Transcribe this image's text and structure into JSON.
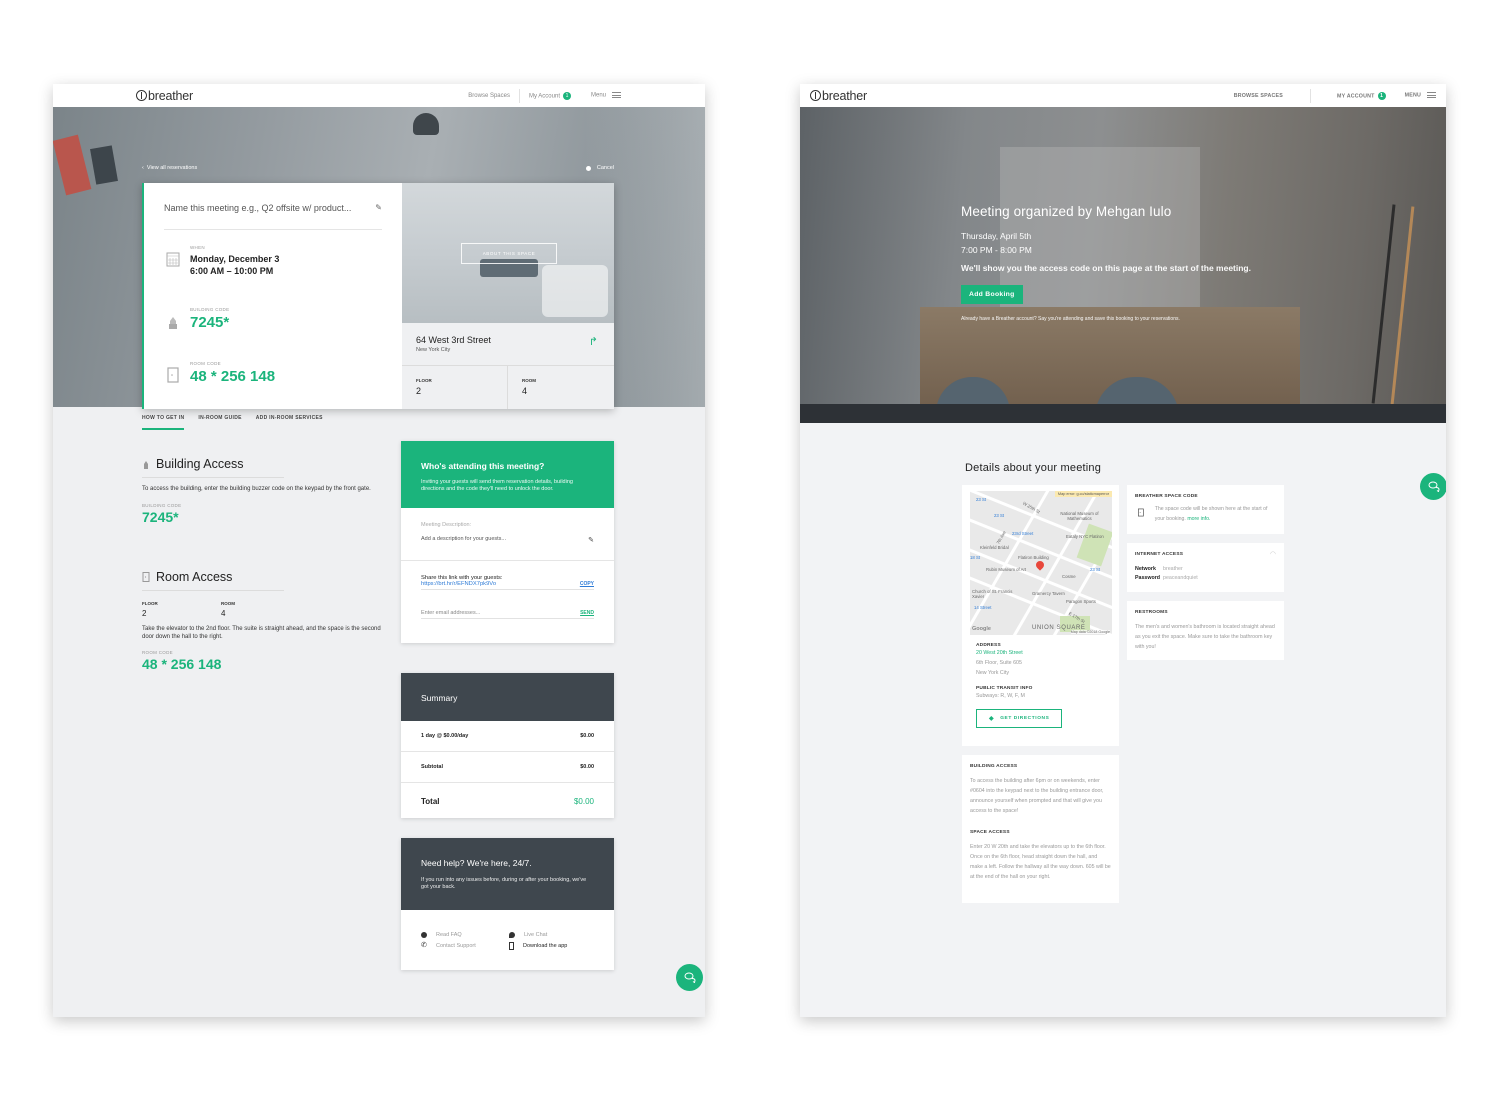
{
  "colors": {
    "accent": "#1bb47c",
    "dark_panel": "#3f474e",
    "link_blue": "#2e7bd6"
  },
  "screen1": {
    "nav": {
      "logo": "breather",
      "browse": "Browse Spaces",
      "account": "My Account",
      "account_badge": "1",
      "menu": "Menu"
    },
    "hero": {
      "back_link": "View all reservations",
      "cancel": "Cancel"
    },
    "reservation": {
      "name_placeholder": "Name this meeting e.g., Q2 offsite w/ product...",
      "when_label": "WHEN",
      "when_date": "Monday, December 3",
      "when_time": "6:00 AM – 10:00 PM",
      "building_code_label": "BUILDING CODE",
      "building_code": "7245*",
      "room_code_label": "ROOM CODE",
      "room_code": "48 * 256 148",
      "about_button": "ABOUT THIS SPACE",
      "street": "64 West 3rd Street",
      "city": "New York City",
      "floor_label": "FLOOR",
      "floor": "2",
      "room_label": "ROOM",
      "room": "4"
    },
    "tabs": [
      {
        "label": "HOW TO GET IN",
        "active": true
      },
      {
        "label": "IN-ROOM GUIDE",
        "active": false
      },
      {
        "label": "ADD IN-ROOM SERVICES",
        "active": false
      }
    ],
    "building_access": {
      "title": "Building Access",
      "text": "To access the building, enter the building buzzer code on the keypad by the front gate.",
      "code_label": "BUILDING CODE",
      "code": "7245*"
    },
    "room_access": {
      "title": "Room Access",
      "floor_label": "FLOOR",
      "floor": "2",
      "room_label": "ROOM",
      "room": "4",
      "text": "Take the elevator to the 2nd floor. The suite is straight ahead, and the space is the second door down the hall to the right.",
      "code_label": "ROOM CODE",
      "code": "48 * 256 148"
    },
    "attending": {
      "title": "Who's attending this meeting?",
      "text": "Inviting your guests will send them reservation details, building directions and the code they'll need to unlock the door.",
      "desc_label": "Meeting Description:",
      "desc_placeholder": "Add a description for your guests...",
      "share_label": "Share this link with your guests:",
      "share_url": "https://brt.hr/r/EFNDX7pk9Vo",
      "copy": "COPY",
      "email_placeholder": "Enter email addresses...",
      "send": "SEND"
    },
    "summary": {
      "title": "Summary",
      "rows": [
        {
          "label": "1 day @ $0.00/day",
          "amount": "$0.00"
        },
        {
          "label": "Subtotal",
          "amount": "$0.00"
        }
      ],
      "total_label": "Total",
      "total": "$0.00"
    },
    "help": {
      "title": "Need help? We're here, 24/7.",
      "text": "If you run into any issues before, during or after your booking, we've got your back.",
      "links": [
        {
          "label": "Read FAQ",
          "icon": "info-icon"
        },
        {
          "label": "Live Chat",
          "icon": "chat-icon"
        },
        {
          "label": "Contact Support",
          "icon": "phone-icon"
        },
        {
          "label": "Download the app",
          "icon": "mobile-icon"
        }
      ]
    }
  },
  "screen2": {
    "nav": {
      "logo": "breather",
      "browse": "BROWSE SPACES",
      "account": "MY ACCOUNT",
      "account_badge": "1",
      "menu": "MENU"
    },
    "hero": {
      "title": "Meeting organized by Mehgan Iulo",
      "date": "Thursday, April 5th",
      "time": "7:00 PM - 8:00 PM",
      "note": "We'll show you the access code on this page at the start of the meeting.",
      "button": "Add Booking",
      "footnote": "Already have a Breather account? Say you're attending and save this booking to your reservations."
    },
    "details_title": "Details about your meeting",
    "map": {
      "error": "Map error: g.co/staticmaperror",
      "labels": [
        "23 St",
        "W 25th St",
        "National Museum of Mathematics",
        "23 St",
        "7th Ave",
        "23rd Street",
        "Eataly NYC Flatiron",
        "Kleinfeld Bridal",
        "18 St",
        "Flatiron Building",
        "Rubin Museum of Art",
        "23 St",
        "Cosme",
        "Church of St. Francis Xavier",
        "Gramercy Tavern",
        "Paragon Sports",
        "14 Street",
        "E 17th St",
        "UNION SQUARE"
      ],
      "attribution": "Map data ©2018 Google",
      "google": "Google"
    },
    "address": {
      "label": "ADDRESS",
      "street": "20 West 20th Street",
      "suite": "6th Floor, Suite 605",
      "city": "New York City",
      "transit_label": "PUBLIC TRANSIT INFO",
      "transit": "Subways: R, W, F, M",
      "directions_button": "GET DIRECTIONS"
    },
    "access": {
      "building_label": "BUILDING ACCESS",
      "building_text": "To access the building after 6pm or on weekends, enter #0604 into the keypad next to the building entrance door, announce yourself when prompted and that will give you access to the space!",
      "space_label": "SPACE ACCESS",
      "space_text": "Enter 20 W 20th and take the elevators up to the 6th floor. Once on the 6th floor, head straight down the hall, and make a left. Follow the hallway all the way down. 605 will be at the end of the hall on your right."
    },
    "space_code": {
      "label": "BREATHER SPACE CODE",
      "text": "The space code will be shown here at the start of your booking.",
      "more": "more info."
    },
    "internet": {
      "label": "INTERNET ACCESS",
      "network_key": "Network",
      "network": "breather",
      "password_key": "Password",
      "password": "peaceandquiet"
    },
    "restrooms": {
      "label": "RESTROOMS",
      "text": "The men's and women's bathroom is located straight ahead as you exit the space. Make sure to take the bathroom key with you!"
    }
  }
}
